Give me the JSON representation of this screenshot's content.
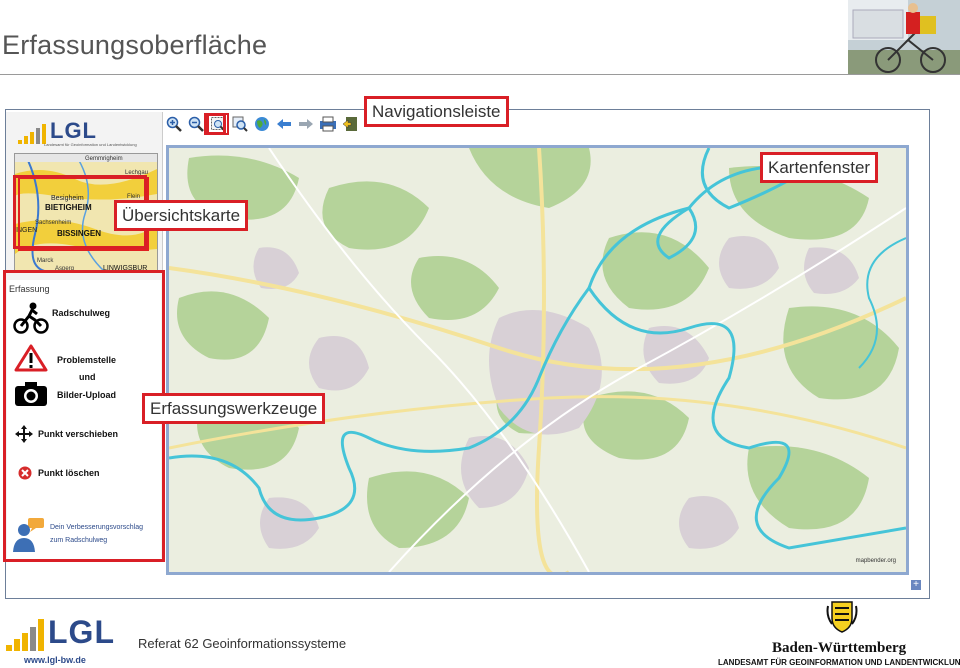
{
  "slide": {
    "title": "Erfassungsoberfläche",
    "footer_referat": "Referat 62 Geoinformationssysteme",
    "footer_url": "www.lgl-bw.de",
    "footer_logo_text": "LGL",
    "state_name": "Baden-Württemberg",
    "agency_name": "LANDESAMT FÜR GEOINFORMATION UND LANDENTWICKLUNG"
  },
  "app": {
    "logo_text": "LGL",
    "logo_subtitle": "Landesamt für Geoinformation und Landentwicklung",
    "erfassung_header": "Erfassung",
    "tools": [
      {
        "label": "Radschulweg",
        "icon": "bicycle-icon"
      },
      {
        "label": "Problemstelle",
        "icon": "warning-icon"
      },
      {
        "label": "und",
        "icon": ""
      },
      {
        "label": "Bilder-Upload",
        "icon": "camera-icon"
      },
      {
        "label": "Punkt verschieben",
        "icon": "move-icon"
      },
      {
        "label": "Punkt löschen",
        "icon": "delete-icon"
      }
    ],
    "suggestion": {
      "line1": "Dein Verbesserungsvorschlag",
      "line2": "zum Radschulweg",
      "icon": "feedback-icon"
    },
    "nav_buttons": [
      "zoom-in-icon",
      "zoom-out-icon",
      "zoom-box-icon",
      "zoom-extent-icon",
      "globe-icon",
      "arrow-back-icon",
      "arrow-forward-icon",
      "print-icon",
      "export-icon"
    ],
    "map_credit": "mapbender.org",
    "zoom_plus": "+",
    "overview_labels": [
      "Gemmrigheim",
      "Lechgau",
      "Besigheim",
      "Flein",
      "BIETIGHEIM",
      "Sachsenheim",
      "BISSINGEN",
      "INGEN",
      "Marck",
      "LINWIGSBUR",
      "Asperg"
    ]
  },
  "callouts": {
    "navigationsleiste": "Navigationsleiste",
    "kartenfenster": "Kartenfenster",
    "uebersichtskarte": "Übersichtskarte",
    "erfassungswerkzeuge": "Erfassungswerkzeuge"
  },
  "colors": {
    "highlight": "#d91f26",
    "map_frame": "#8ea8d0",
    "river": "#45c4d8",
    "forest": "#b5d39a",
    "lgl_yellow": "#f0b400",
    "lgl_blue": "#2c4a8a"
  }
}
